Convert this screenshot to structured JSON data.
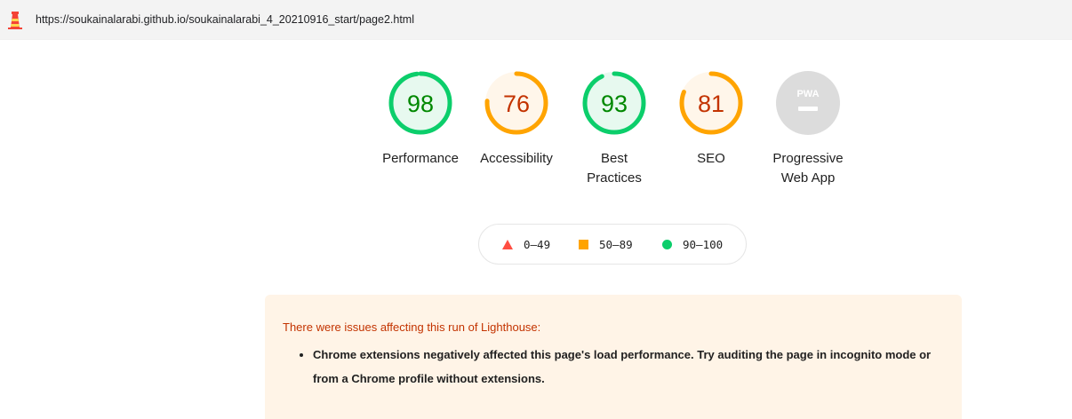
{
  "url": "https://soukainalarabi.github.io/soukainalarabi_4_20210916_start/page2.html",
  "gauges": [
    {
      "id": "performance",
      "score": "98",
      "score_value": 98,
      "label": "Performance",
      "status": "pass"
    },
    {
      "id": "accessibility",
      "score": "76",
      "score_value": 76,
      "label": "Accessibility",
      "status": "average"
    },
    {
      "id": "best-practices",
      "score": "93",
      "score_value": 93,
      "label_line1": "Best",
      "label_line2": "Practices",
      "status": "pass"
    },
    {
      "id": "seo",
      "score": "81",
      "score_value": 81,
      "label": "SEO",
      "status": "average"
    },
    {
      "id": "pwa",
      "badge": "PWA",
      "label_line1": "Progressive",
      "label_line2": "Web App",
      "status": "na"
    }
  ],
  "legend": {
    "fail": "0–49",
    "average": "50–89",
    "pass": "90–100"
  },
  "colors": {
    "pass": "#0cce6b",
    "pass_text": "#008800",
    "pass_bg": "#e7f9ef",
    "average": "#ffa400",
    "average_text": "#c33300",
    "average_bg": "#fff6ea",
    "fail": "#ff4e42",
    "na": "#cccccc",
    "warning_bg": "#fff4e7",
    "warning_title": "#c33300"
  },
  "warning": {
    "title": "There were issues affecting this run of Lighthouse:",
    "items": [
      "Chrome extensions negatively affected this page's load performance. Try auditing the page in incognito mode or from a Chrome profile without extensions."
    ]
  }
}
